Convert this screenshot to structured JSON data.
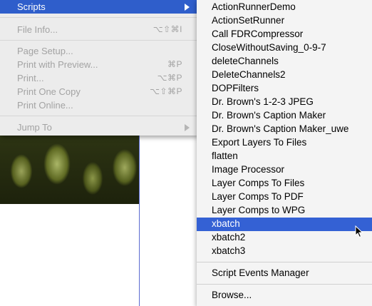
{
  "file_menu": {
    "scripts_item": "Scripts",
    "items": [
      {
        "label": "File Info...",
        "shortcut": "⌥⇧⌘I"
      },
      {
        "label": "Page Setup...",
        "shortcut": ""
      },
      {
        "label": "Print with Preview...",
        "shortcut": "⌘P"
      },
      {
        "label": "Print...",
        "shortcut": "⌥⌘P"
      },
      {
        "label": "Print One Copy",
        "shortcut": "⌥⇧⌘P"
      },
      {
        "label": "Print Online...",
        "shortcut": ""
      },
      {
        "label": "Jump To",
        "shortcut": ""
      }
    ]
  },
  "scripts_submenu": {
    "items": [
      "ActionRunnerDemo",
      "ActionSetRunner",
      "Call FDRCompressor",
      "CloseWithoutSaving_0-9-7",
      "deleteChannels",
      "DeleteChannels2",
      "DOPFilters",
      "Dr. Brown's 1-2-3 JPEG",
      "Dr. Brown's Caption Maker",
      "Dr. Brown's Caption Maker_uwe",
      "Export Layers To Files",
      "flatten",
      "Image Processor",
      "Layer Comps To Files",
      "Layer Comps To PDF",
      "Layer Comps to WPG",
      "xbatch",
      "xbatch2",
      "xbatch3"
    ],
    "selected": "xbatch",
    "script_events_manager": "Script Events Manager",
    "browse": "Browse..."
  },
  "icons": [
    "submenu-arrow-icon",
    "mouse-pointer-icon"
  ],
  "colors": {
    "highlight": "#3461d4",
    "menu_bg": "#ececec",
    "disabled_text": "#a3a3a3"
  }
}
